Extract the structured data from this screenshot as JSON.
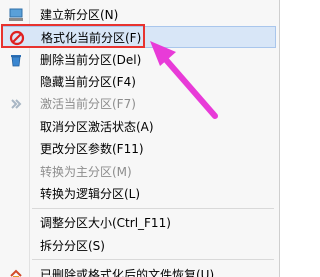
{
  "menu": {
    "items": [
      {
        "label": "建立新分区(N)",
        "icon": "new-partition-icon",
        "disabled": false
      },
      {
        "label": "格式化当前分区(F)",
        "icon": "format-prohibit-icon",
        "disabled": false,
        "highlighted": true
      },
      {
        "label": "删除当前分区(Del)",
        "icon": "trash-icon",
        "disabled": false
      },
      {
        "label": "隐藏当前分区(F4)",
        "icon": "",
        "disabled": false
      },
      {
        "label": "激活当前分区(F7)",
        "icon": "activate-icon",
        "disabled": true
      },
      {
        "label": "取消分区激活状态(A)",
        "icon": "",
        "disabled": false
      },
      {
        "label": "更改分区参数(F11)",
        "icon": "",
        "disabled": false
      },
      {
        "label": "转换为主分区(M)",
        "icon": "",
        "disabled": true
      },
      {
        "label": "转换为逻辑分区(L)",
        "icon": "",
        "disabled": false
      },
      {
        "label": "调整分区大小(Ctrl_F11)",
        "icon": "",
        "disabled": false
      },
      {
        "label": "拆分分区(S)",
        "icon": "",
        "disabled": false
      },
      {
        "label": "已删除或格式化后的文件恢复(U)",
        "icon": "recover-icon",
        "disabled": false
      }
    ]
  },
  "annotation": {
    "box_color": "#e8332f",
    "arrow_color": "#e83bd8"
  }
}
